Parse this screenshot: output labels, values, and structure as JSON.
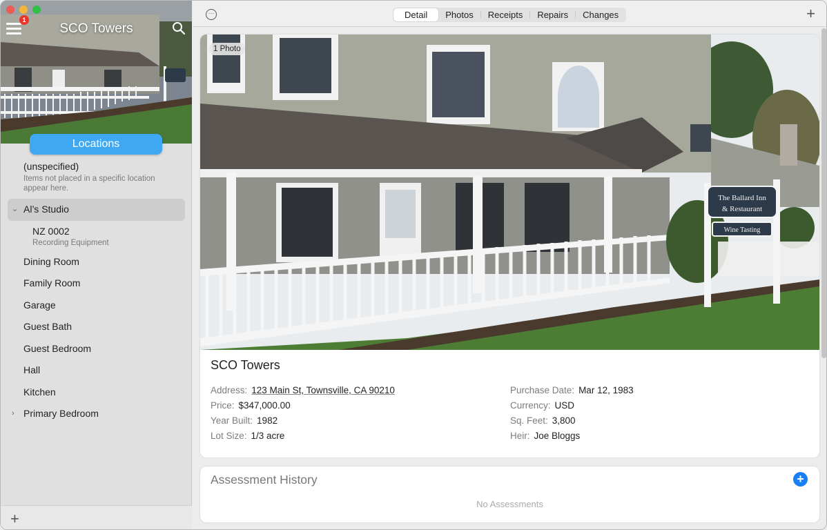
{
  "window": {
    "title": "SCO Towers",
    "notification_count": "1"
  },
  "sidebar": {
    "locations_button": "Locations",
    "unspecified": {
      "title": "(unspecified)",
      "subtitle": "Items not placed in a specific location appear here."
    },
    "items": [
      {
        "label": "Al’s Studio",
        "expanded": true,
        "selected": true
      },
      {
        "label": "Dining Room"
      },
      {
        "label": "Family Room"
      },
      {
        "label": "Garage"
      },
      {
        "label": "Guest Bath"
      },
      {
        "label": "Guest Bedroom"
      },
      {
        "label": "Hall"
      },
      {
        "label": "Kitchen"
      },
      {
        "label": "Primary Bedroom",
        "expandable": true
      }
    ],
    "sub_item": {
      "title": "NZ 0002",
      "subtitle": "Recording Equipment"
    }
  },
  "toolbar": {
    "tabs": [
      {
        "label": "Detail",
        "active": true
      },
      {
        "label": "Photos"
      },
      {
        "label": "Receipts"
      },
      {
        "label": "Repairs"
      },
      {
        "label": "Changes"
      }
    ]
  },
  "detail": {
    "photo_badge": "1 Photo",
    "title": "SCO Towers",
    "left_fields": [
      {
        "label": "Address:",
        "value": "123 Main St, Townsville, CA 90210",
        "link": true
      },
      {
        "label": "Price:",
        "value": "$347,000.00"
      },
      {
        "label": "Year Built:",
        "value": "1982"
      },
      {
        "label": "Lot Size:",
        "value": "1/3 acre"
      }
    ],
    "right_fields": [
      {
        "label": "Purchase Date:",
        "value": "Mar 12, 1983"
      },
      {
        "label": "Currency:",
        "value": "USD"
      },
      {
        "label": "Sq. Feet:",
        "value": "3,800"
      },
      {
        "label": "Heir:",
        "value": "Joe Bloggs"
      }
    ],
    "photo_sign": {
      "line1": "The Ballard Inn",
      "line2": "& Restaurant",
      "line3": "Wine Tasting"
    }
  },
  "assessment": {
    "title": "Assessment History",
    "empty_text": "No Assessments"
  },
  "colors": {
    "accent": "#3ea8f3",
    "add_button": "#1a7ef5",
    "badge": "#e8342b"
  }
}
